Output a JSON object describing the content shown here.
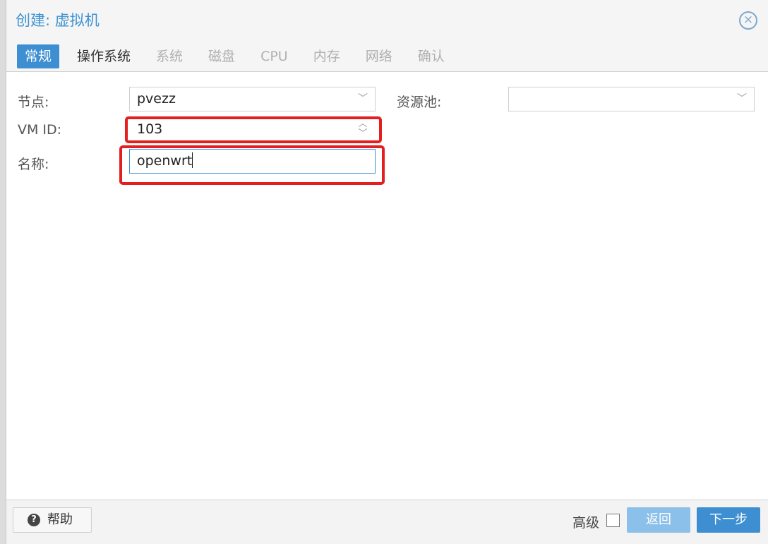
{
  "dialog": {
    "title": "创建: 虚拟机",
    "close_glyph": "×"
  },
  "tabs": [
    {
      "label": "常规",
      "state": "active"
    },
    {
      "label": "操作系统",
      "state": "enabled"
    },
    {
      "label": "系统",
      "state": "disabled"
    },
    {
      "label": "磁盘",
      "state": "disabled"
    },
    {
      "label": "CPU",
      "state": "disabled"
    },
    {
      "label": "内存",
      "state": "disabled"
    },
    {
      "label": "网络",
      "state": "disabled"
    },
    {
      "label": "确认",
      "state": "disabled"
    }
  ],
  "form": {
    "node_label": "节点:",
    "node_value": "pvezz",
    "pool_label": "资源池:",
    "pool_value": "",
    "vmid_label": "VM ID:",
    "vmid_value": "103",
    "name_label": "名称:",
    "name_value": "openwrt"
  },
  "footer": {
    "help_label": "帮助",
    "help_glyph": "?",
    "advanced_label": "高级",
    "back_label": "返回",
    "next_label": "下一步"
  },
  "colors": {
    "accent": "#3d8fd1",
    "highlight": "#e41f1f"
  }
}
